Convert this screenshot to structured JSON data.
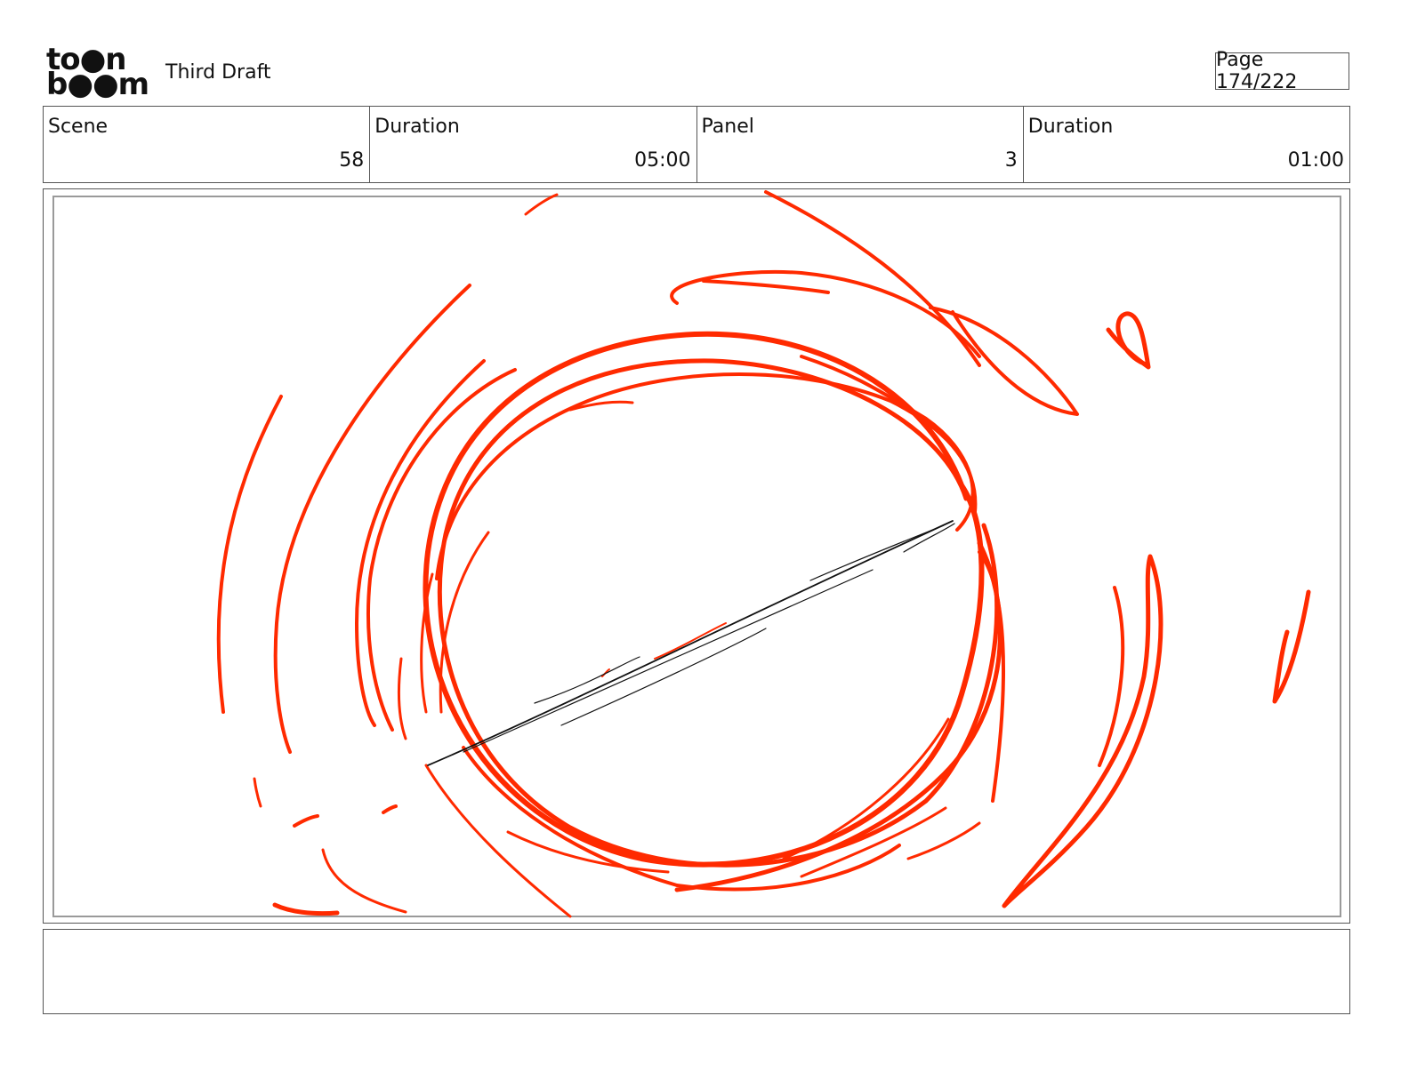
{
  "header": {
    "logo": {
      "line1": "to●n",
      "line2": "b●●m",
      "icon": "toon-boom-logo"
    },
    "title": "Third Draft",
    "page": "Page 174/222"
  },
  "info": [
    {
      "label": "Scene",
      "value": "58"
    },
    {
      "label": "Duration",
      "value": "05:00"
    },
    {
      "label": "Panel",
      "value": "3"
    },
    {
      "label": "Duration",
      "value": "01:00"
    }
  ],
  "panel": {
    "sketch_colors": {
      "red": "#ff2a00",
      "black": "#111111"
    },
    "content": "red-circle-swirl-sketch-icon"
  },
  "caption": {
    "text": ""
  }
}
